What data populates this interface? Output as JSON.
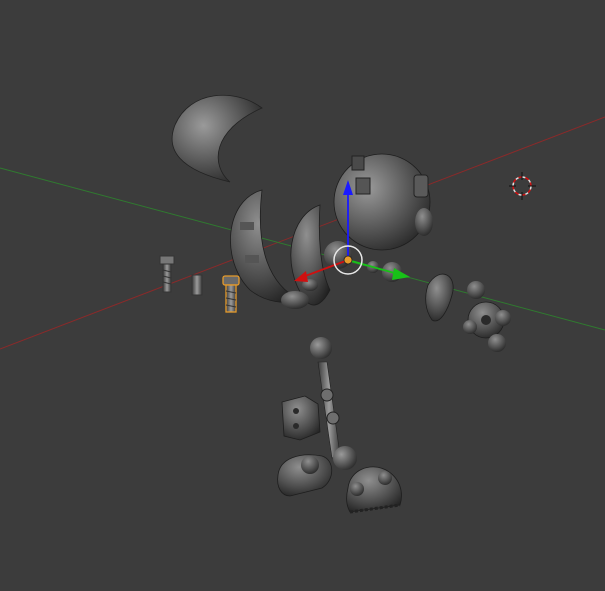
{
  "viewport": {
    "name": "3D Viewport",
    "background": "#3c3c3c",
    "axis_colors": {
      "x_axis_line": "#8a2a2a",
      "y_axis_line": "#2f7a2f",
      "gizmo_x": "#d01010",
      "gizmo_y": "#18c218",
      "gizmo_z": "#1a1aff",
      "selected_outline": "#e79b2a"
    },
    "icons": {
      "cursor": "3d-cursor-icon",
      "gizmo": "transform-gizmo-icon"
    }
  }
}
